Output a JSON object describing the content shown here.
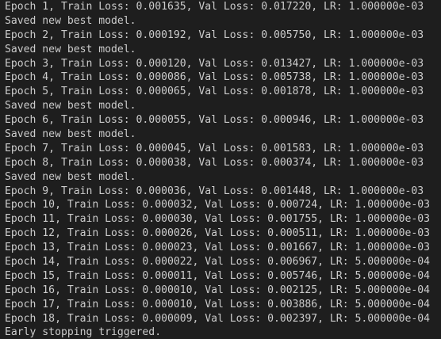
{
  "output": {
    "lines": [
      "Epoch 1, Train Loss: 0.001635, Val Loss: 0.017220, LR: 1.000000e-03",
      "Saved new best model.",
      "Epoch 2, Train Loss: 0.000192, Val Loss: 0.005750, LR: 1.000000e-03",
      "Saved new best model.",
      "Epoch 3, Train Loss: 0.000120, Val Loss: 0.013427, LR: 1.000000e-03",
      "Epoch 4, Train Loss: 0.000086, Val Loss: 0.005738, LR: 1.000000e-03",
      "Epoch 5, Train Loss: 0.000065, Val Loss: 0.001878, LR: 1.000000e-03",
      "Saved new best model.",
      "Epoch 6, Train Loss: 0.000055, Val Loss: 0.000946, LR: 1.000000e-03",
      "Saved new best model.",
      "Epoch 7, Train Loss: 0.000045, Val Loss: 0.001583, LR: 1.000000e-03",
      "Epoch 8, Train Loss: 0.000038, Val Loss: 0.000374, LR: 1.000000e-03",
      "Saved new best model.",
      "Epoch 9, Train Loss: 0.000036, Val Loss: 0.001448, LR: 1.000000e-03",
      "Epoch 10, Train Loss: 0.000032, Val Loss: 0.000724, LR: 1.000000e-03",
      "Epoch 11, Train Loss: 0.000030, Val Loss: 0.001755, LR: 1.000000e-03",
      "Epoch 12, Train Loss: 0.000026, Val Loss: 0.000511, LR: 1.000000e-03",
      "Epoch 13, Train Loss: 0.000023, Val Loss: 0.001667, LR: 1.000000e-03",
      "Epoch 14, Train Loss: 0.000022, Val Loss: 0.006967, LR: 5.000000e-04",
      "Epoch 15, Train Loss: 0.000011, Val Loss: 0.005746, LR: 5.000000e-04",
      "Epoch 16, Train Loss: 0.000010, Val Loss: 0.002125, LR: 5.000000e-04",
      "Epoch 17, Train Loss: 0.000010, Val Loss: 0.003886, LR: 5.000000e-04",
      "Epoch 18, Train Loss: 0.000009, Val Loss: 0.002397, LR: 5.000000e-04",
      "Early stopping triggered."
    ]
  },
  "colors": {
    "background": "#1e1e1e",
    "text": "#cccccc"
  }
}
